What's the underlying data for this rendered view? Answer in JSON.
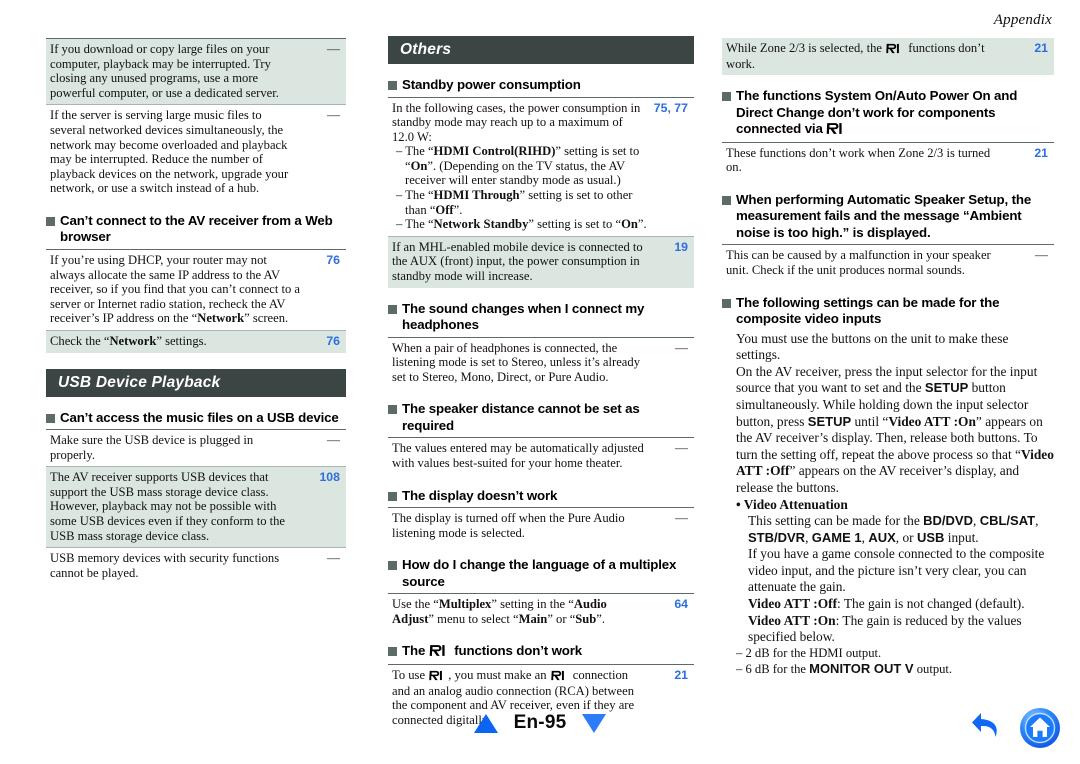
{
  "header": {
    "appendix": "Appendix"
  },
  "footer": {
    "page_label": "En-95",
    "prev_icon": "triangle-up-icon",
    "next_icon": "triangle-down-icon",
    "back_icon": "back-arrow-icon",
    "home_icon": "home-icon"
  },
  "col1": {
    "top_table": {
      "rows": [
        {
          "shaded": true,
          "text": "If you download or copy large files on your computer, playback may be interrupted. Try closing any unused programs, use a more powerful computer, or use a dedicated server.",
          "page": "—"
        },
        {
          "shaded": false,
          "text": "If the server is serving large music files to several networked devices simultaneously, the network may become overloaded and playback may be interrupted. Reduce the number of playback devices on the network, upgrade your network, or use a switch instead of a hub.",
          "page": "—"
        }
      ]
    },
    "q1": {
      "heading": "Can’t connect to the AV receiver from a Web browser",
      "rows": [
        {
          "shaded": false,
          "page": "76"
        },
        {
          "shaded": true,
          "page": "76"
        }
      ]
    },
    "section_bar": "USB Device Playback",
    "q2": {
      "heading": "Can’t access the music files on a USB device",
      "rows": [
        {
          "shaded": false,
          "text": "Make sure the USB device is plugged in properly.",
          "page": "—"
        },
        {
          "shaded": true,
          "text": "The AV receiver supports USB devices that support the USB mass storage device class. However, playback may not be possible with some USB devices even if they conform to the USB mass storage device class.",
          "page": "108"
        },
        {
          "shaded": false,
          "text": "USB memory devices with security functions cannot be played.",
          "page": "—"
        }
      ]
    }
  },
  "col2": {
    "section_bar": "Others",
    "q1": {
      "heading": "Standby power consumption",
      "row1_page": "75, 77",
      "row2_page": "19",
      "row2_text": "If an MHL-enabled mobile device is connected to the AUX (front) input, the power consumption in standby mode will increase."
    },
    "q2": {
      "heading": "The sound changes when I connect my headphones",
      "text": "When a pair of headphones is connected, the listening mode is set to Stereo, unless it’s already set to Stereo, Mono, Direct, or Pure Audio.",
      "page": "—"
    },
    "q3": {
      "heading": "The speaker distance cannot be set as required",
      "text": "The values entered may be automatically adjusted with values best-suited for your home theater.",
      "page": "—"
    },
    "q4": {
      "heading": "The display doesn’t work",
      "text": "The display is turned off when the Pure Audio listening mode is selected.",
      "page": "—"
    },
    "q5": {
      "heading": "How do I change the language of a multiplex source",
      "page": "64"
    },
    "q6": {
      "heading_pre": "The ",
      "heading_post": " functions don’t work",
      "page": "21"
    }
  },
  "col3": {
    "row_top": {
      "page": "21"
    },
    "q1": {
      "heading_pre": "The functions System On/Auto Power On and Direct Change don’t work for components connected via ",
      "text": "These functions don’t work when Zone 2/3 is turned on.",
      "page": "21"
    },
    "q2": {
      "heading": "When performing Automatic Speaker Setup, the measurement fails and the message “Ambient noise is too high.” is displayed.",
      "text": "This can be caused by a malfunction in your speaker unit. Check if the unit produces normal sounds.",
      "page": "—"
    },
    "q3": {
      "heading": "The following settings can be made for the composite video inputs",
      "p1": "You must use the buttons on the unit to make these settings.",
      "bullet_title": "Video Attenuation",
      "p3": "If you have a game console connected to the composite video input, and the picture isn’t very clear, you can attenuate the gain.",
      "dash1": "– 2 dB for the HDMI output.",
      "dash2_pre": "– 6 dB for the ",
      "dash2_bold": "MONITOR OUT V",
      "dash2_post": " output."
    }
  }
}
